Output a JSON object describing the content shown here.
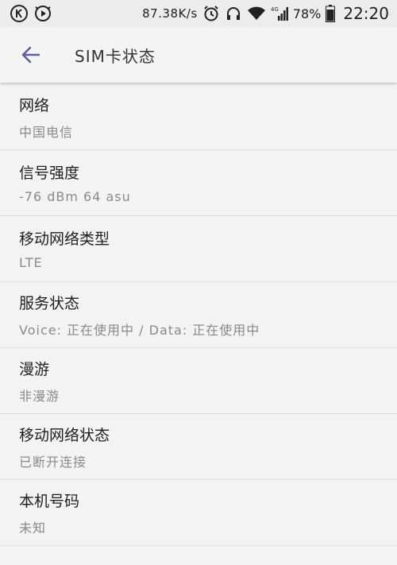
{
  "status_bar": {
    "speed": "87.38K/s",
    "battery_pct": "78%",
    "time": "22:20",
    "network_badge": "4G"
  },
  "app_bar": {
    "title": "SIM卡状态"
  },
  "items": [
    {
      "title": "网络",
      "value": "中国电信"
    },
    {
      "title": "信号强度",
      "value": "-76 dBm 64 asu"
    },
    {
      "title": "移动网络类型",
      "value": "LTE"
    },
    {
      "title": "服务状态",
      "value": "Voice: 正在使用中 / Data: 正在使用中"
    },
    {
      "title": "漫游",
      "value": "非漫游"
    },
    {
      "title": "移动网络状态",
      "value": "已断开连接"
    },
    {
      "title": "本机号码",
      "value": "未知"
    }
  ],
  "colors": {
    "accent": "#5c5c9e",
    "background": "#f3f3f3"
  }
}
